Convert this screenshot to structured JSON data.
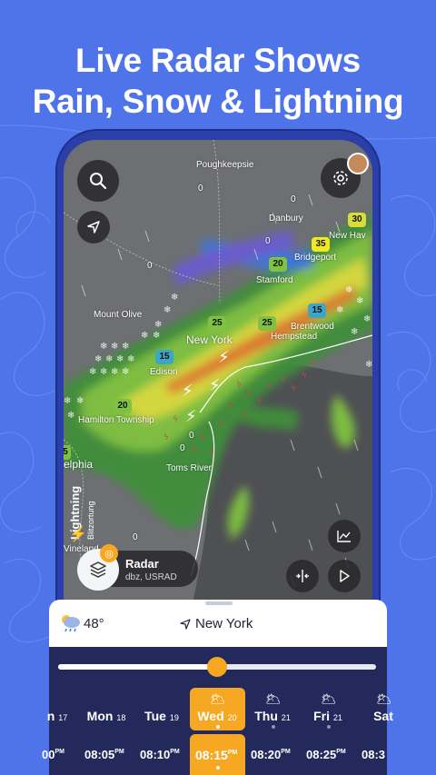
{
  "headline": {
    "line1": "Live Radar Shows",
    "line2": "Rain, Snow & Lightning"
  },
  "colors": {
    "background": "#4f74ea",
    "phone_frame": "#2a3fa8",
    "timeline_bg": "#232a5b",
    "accent_orange": "#f7a823"
  },
  "map": {
    "places": {
      "poughkeepsie": "Poughkeepsie",
      "danbury": "Danbury",
      "new_haven": "New Hav",
      "bridgeport": "Bridgeport",
      "stamford": "Stamford",
      "mount_olive": "Mount Olive",
      "new_york": "New York",
      "hempstead": "Hempstead",
      "brentwood": "Brentwood",
      "edison": "Edison",
      "hamilton_township": "Hamilton Township",
      "philadelphia": "elphia",
      "toms_river": "Toms River",
      "vineland": "Vineland"
    },
    "zero_values": [
      "0",
      "0",
      "0",
      "0",
      "0",
      "0",
      "0"
    ],
    "dbz_badges": [
      "30",
      "35",
      "20",
      "25",
      "25",
      "15",
      "15",
      "20",
      "5"
    ],
    "lightning_legend": {
      "title": "Lightning",
      "subtitle": "Blitzortung"
    }
  },
  "controls": {
    "search_icon": "search-icon",
    "locate_icon": "navigation-arrow-icon",
    "settings_icon": "gear-icon",
    "chart_icon": "chart-icon",
    "compare_icon": "split-compare-icon",
    "play_icon": "play-icon",
    "layers_icon": "layers-icon"
  },
  "layer": {
    "name": "Radar",
    "source": "dbz, USRAD"
  },
  "sheet": {
    "temperature": "48°",
    "location": "New York",
    "weather_icon": "cloud-rain-sun-icon"
  },
  "timeline": {
    "slider_fraction": 0.5,
    "days": [
      {
        "label": "n",
        "num": "17"
      },
      {
        "label": "Mon",
        "num": "18"
      },
      {
        "label": "Tue",
        "num": "19"
      },
      {
        "label": "Wed",
        "num": "20"
      },
      {
        "label": "Thu",
        "num": "21"
      },
      {
        "label": "Fri",
        "num": "21"
      },
      {
        "label": "Sat",
        "num": ""
      }
    ],
    "times": [
      {
        "value": "00",
        "ampm": "PM"
      },
      {
        "value": "08:05",
        "ampm": "PM"
      },
      {
        "value": "08:10",
        "ampm": "PM"
      },
      {
        "value": "08:15",
        "ampm": "PM"
      },
      {
        "value": "08:20",
        "ampm": "PM"
      },
      {
        "value": "08:25",
        "ampm": "PM"
      },
      {
        "value": "08:3",
        "ampm": ""
      }
    ]
  }
}
